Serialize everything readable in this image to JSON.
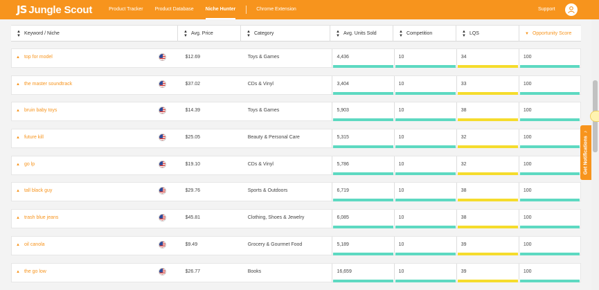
{
  "brand": {
    "mark": "JS",
    "name": "Jungle Scout"
  },
  "nav": {
    "items": [
      {
        "label": "Product Tracker",
        "active": false
      },
      {
        "label": "Product Database",
        "active": false
      },
      {
        "label": "Niche Hunter",
        "active": true
      }
    ],
    "extension": "Chrome Extension",
    "support": "Support"
  },
  "colors": {
    "accent": "#f7941d",
    "green_bar": "#5dd9c1",
    "yellow_bar": "#f5dc2c"
  },
  "table": {
    "columns": [
      {
        "label": "Keyword / Niche",
        "icon": "sort-icon"
      },
      {
        "label": "Avg. Price",
        "icon": "sort-icon"
      },
      {
        "label": "Category",
        "icon": "sort-icon"
      },
      {
        "label": "Avg. Units Sold",
        "icon": "sort-icon"
      },
      {
        "label": "Competition",
        "icon": "sort-icon"
      },
      {
        "label": "LQS",
        "icon": "sort-icon"
      },
      {
        "label": "Opportunity Score",
        "icon": "sort-desc-icon",
        "active": true
      }
    ],
    "rows": [
      {
        "keyword": "top for model",
        "price": "$12.69",
        "category": "Toys & Games",
        "units": "4,436",
        "competition": "10",
        "lqs": "34",
        "opportunity": "100"
      },
      {
        "keyword": "the master soundtrack",
        "price": "$37.02",
        "category": "CDs & Vinyl",
        "units": "3,404",
        "competition": "10",
        "lqs": "33",
        "opportunity": "100"
      },
      {
        "keyword": "bruin baby toys",
        "price": "$14.39",
        "category": "Toys & Games",
        "units": "5,903",
        "competition": "10",
        "lqs": "38",
        "opportunity": "100"
      },
      {
        "keyword": "future kill",
        "price": "$25.05",
        "category": "Beauty & Personal Care",
        "units": "5,315",
        "competition": "10",
        "lqs": "32",
        "opportunity": "100"
      },
      {
        "keyword": "go lp",
        "price": "$19.10",
        "category": "CDs & Vinyl",
        "units": "5,786",
        "competition": "10",
        "lqs": "32",
        "opportunity": "100"
      },
      {
        "keyword": "tall black guy",
        "price": "$29.76",
        "category": "Sports & Outdoors",
        "units": "6,719",
        "competition": "10",
        "lqs": "38",
        "opportunity": "100"
      },
      {
        "keyword": "trash blue jeans",
        "price": "$45.81",
        "category": "Clothing, Shoes & Jewelry",
        "units": "6,085",
        "competition": "10",
        "lqs": "38",
        "opportunity": "100"
      },
      {
        "keyword": "oil canola",
        "price": "$9.49",
        "category": "Grocery & Gourmet Food",
        "units": "5,189",
        "competition": "10",
        "lqs": "39",
        "opportunity": "100"
      },
      {
        "keyword": "the go low",
        "price": "$26.77",
        "category": "Books",
        "units": "16,659",
        "competition": "10",
        "lqs": "39",
        "opportunity": "100"
      }
    ],
    "row_flag_icon": "us-flag-icon",
    "row_expand_icon": "caret-up-icon"
  },
  "notifications": {
    "label": "Get Notifications",
    "icon": "bell-icon"
  }
}
